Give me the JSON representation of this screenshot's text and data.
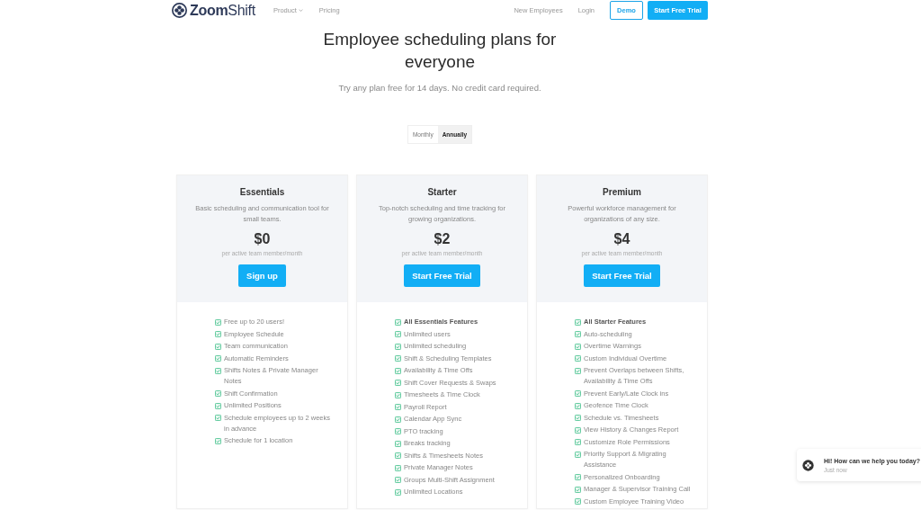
{
  "nav": {
    "logo": "**Zoom**Shift",
    "links": [
      {
        "label": "Product",
        "dropdown": true
      },
      {
        "label": "Pricing",
        "dropdown": false
      }
    ],
    "right_links": [
      "New Employees",
      "Login"
    ],
    "demo_button": "Demo",
    "trial_button": "Start Free Trial"
  },
  "hero": {
    "title": "Employee scheduling plans for everyone",
    "subtitle": "Try any plan free for 14 days. No credit card required."
  },
  "billing_toggle": [
    {
      "label": "Monthly",
      "selected": false
    },
    {
      "label": "Annually",
      "selected": true
    }
  ],
  "plans": [
    {
      "name": "Essentials",
      "description": "Basic scheduling and communication tool for small teams.",
      "price": "$0",
      "unit": "per active team member/month",
      "button": "Sign up",
      "features": [
        {
          "text": "Free up to 20 users!",
          "bold": false
        },
        {
          "text": "Employee Schedule",
          "bold": false
        },
        {
          "text": "Team communication",
          "bold": false
        },
        {
          "text": "Automatic Reminders",
          "bold": false
        },
        {
          "text": "Shifts Notes & Private Manager Notes",
          "bold": false
        },
        {
          "text": "Shift Confirmation",
          "bold": false
        },
        {
          "text": "Unlimited Positions",
          "bold": false
        },
        {
          "text": "Schedule employees up to 2 weeks in advance",
          "bold": false
        },
        {
          "text": "Schedule for 1 location",
          "bold": false
        }
      ]
    },
    {
      "name": "Starter",
      "description": "Top-notch scheduling and time tracking for growing organizations.",
      "price": "$2",
      "unit": "per active team member/month",
      "button": "Start Free Trial",
      "features": [
        {
          "text": "All Essentials Features",
          "bold": true
        },
        {
          "text": "Unlimited users",
          "bold": false
        },
        {
          "text": "Unlimited scheduling",
          "bold": false
        },
        {
          "text": "Shift & Scheduling Templates",
          "bold": false
        },
        {
          "text": "Availability & Time Offs",
          "bold": false
        },
        {
          "text": "Shift Cover Requests & Swaps",
          "bold": false
        },
        {
          "text": "Timesheets & Time Clock",
          "bold": false
        },
        {
          "text": "Payroll Report",
          "bold": false
        },
        {
          "text": "Calendar App Sync",
          "bold": false
        },
        {
          "text": "PTO tracking",
          "bold": false
        },
        {
          "text": "Breaks tracking",
          "bold": false
        },
        {
          "text": "Shifts & Timesheets Notes",
          "bold": false
        },
        {
          "text": "Private Manager Notes",
          "bold": false
        },
        {
          "text": "Groups Multi-Shift Assignment",
          "bold": false
        },
        {
          "text": "Unlimited Locations",
          "bold": false
        }
      ]
    },
    {
      "name": "Premium",
      "description": "Powerful workforce management for organizations of any size.",
      "price": "$4",
      "unit": "per active team member/month",
      "button": "Start Free Trial",
      "features": [
        {
          "text": "All Starter Features",
          "bold": true
        },
        {
          "text": "Auto-scheduling",
          "bold": false
        },
        {
          "text": "Overtime Warnings",
          "bold": false
        },
        {
          "text": "Custom Individual Overtime",
          "bold": false
        },
        {
          "text": "Prevent Overlaps between Shifts, Availability & Time Offs",
          "bold": false
        },
        {
          "text": "Prevent Early/Late Clock ins",
          "bold": false
        },
        {
          "text": "Geofence Time Clock",
          "bold": false
        },
        {
          "text": "Schedule vs. Timesheets",
          "bold": false
        },
        {
          "text": "View History & Changes Report",
          "bold": false
        },
        {
          "text": "Customize Role Permissions",
          "bold": false
        },
        {
          "text": "Priority Support & Migrating Assistance",
          "bold": false
        },
        {
          "text": "Personalized Onboarding",
          "bold": false
        },
        {
          "text": "Manager & Supervisor Training Call",
          "bold": false
        },
        {
          "text": "Custom Employee Training Video",
          "bold": false
        }
      ]
    }
  ],
  "chat": {
    "message": "Hi! How can we help you today?",
    "time": "Just now"
  }
}
